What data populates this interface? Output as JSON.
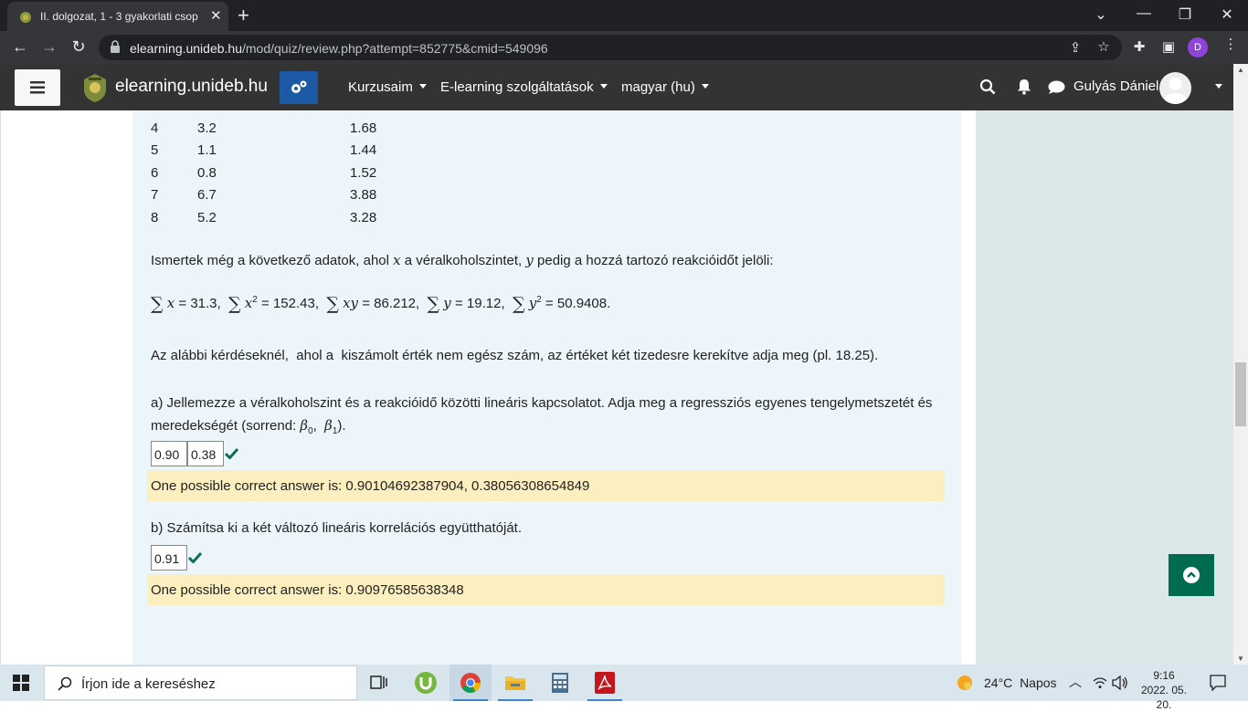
{
  "browser": {
    "tab_title": "II. dolgozat, 1 - 3 gyakorlati csop",
    "tab_close": "✕",
    "new_tab": "+",
    "url_host": "elearning.unideb.hu",
    "url_path": "/mod/quiz/review.php?attempt=852775&cmid=549096",
    "profile_initial": "D"
  },
  "navbar": {
    "site_name": "elearning.unideb.hu",
    "menu": [
      "Kurzusaim",
      "E-learning szolgáltatások",
      "magyar (hu)"
    ],
    "user_name": "Gulyás Dániel"
  },
  "table_rows": [
    {
      "i": "4",
      "x": "3.2",
      "y": "1.68"
    },
    {
      "i": "5",
      "x": "1.1",
      "y": "1.44"
    },
    {
      "i": "6",
      "x": "0.8",
      "y": "1.52"
    },
    {
      "i": "7",
      "x": "6.7",
      "y": "3.88"
    },
    {
      "i": "8",
      "x": "5.2",
      "y": "3.28"
    }
  ],
  "question": {
    "intro_before_x": "Ismertek még a következő adatok, ahol ",
    "var_x": "x",
    "intro_mid": " a véralkoholszintet, ",
    "var_y": "y",
    "intro_after": " pedig a hozzá tartozó reakcióidőt jelöli:",
    "sums": {
      "sum_x": "31.3",
      "sum_x2": "152.43",
      "sum_xy": "86.212",
      "sum_y": "19.12",
      "sum_y2": "50.9408"
    },
    "rounding_note": "Az alábbi kérdéseknél,  ahol a  kiszámolt érték nem egész szám, az értéket két tizedesre kerekítve adja meg (pl. 18.25).",
    "part_a_line1": "a) Jellemezze a véralkoholszint és a reakcióidő közötti lineáris kapcsolatot. Adja meg a regressziós egyenes tengelymetszetét és",
    "part_a_line2_prefix": "meredekségét (sorrend: ",
    "beta0": "β",
    "beta0_sub": "0",
    "beta1": "β",
    "beta1_sub": "1",
    "part_a_line2_suffix": ").",
    "answer_a1": "0.90",
    "answer_a2": "0.38",
    "feedback_a": "One possible correct answer is: 0.90104692387904, 0.38056308654849",
    "part_b": "b) Számítsa ki a két változó lineáris korrelációs együtthatóját.",
    "answer_b": "0.91",
    "feedback_b": "One possible correct answer is: 0.90976585638348"
  },
  "taskbar": {
    "search_placeholder": "Írjon ide a kereséshez",
    "weather_temp": "24°C",
    "weather_desc": "Napos",
    "time": "9:16",
    "date": "2022. 05. 20."
  },
  "colors": {
    "navbar_bg": "#333333",
    "accent_blue": "#1d5aa6",
    "feedback_bg": "#fcefbf",
    "check_green": "#0f6e52",
    "totop_green": "#006b4e"
  }
}
